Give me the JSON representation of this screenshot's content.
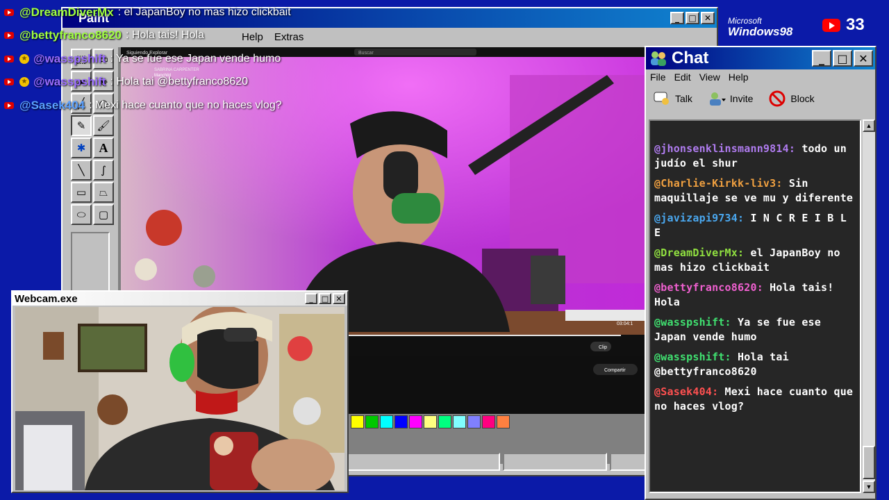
{
  "paint": {
    "title": "Paint",
    "menu": [
      "Help",
      "Extras"
    ],
    "palette": [
      "#ffff00",
      "#00ff00",
      "#00ffff",
      "#0000ff",
      "#ff00ff",
      "#ffff80",
      "#00ff80",
      "#80ffff",
      "#8080ff",
      "#ff0080",
      "#ff8040"
    ]
  },
  "stream_video": {
    "search_placeholder": "Buscar",
    "tabs": "Siguiendo   Explorar",
    "now_playing": "SABRINA CARPENTER",
    "now_playing_sub": "Manchild",
    "timestamp": "03:04:1",
    "clip_label": "Clip",
    "share_label": "Compartir"
  },
  "webcam": {
    "title": "Webcam.exe"
  },
  "chat": {
    "title": "Chat",
    "menu": [
      "File",
      "Edit",
      "View",
      "Help"
    ],
    "toolbar": {
      "talk": "Talk",
      "invite": "Invite",
      "block": "Block"
    },
    "messages": [
      {
        "user": "@jhonsenklinsmann9814:",
        "color": "#b07cf0",
        "text": "todo un judío el shur"
      },
      {
        "user": "@Charlie-Kirkk-liv3:",
        "color": "#f0a040",
        "text": "Sin maquillaje se ve mu y diferente"
      },
      {
        "user": "@javizapi9734:",
        "color": "#4aa8f0",
        "text": "I N C R E I B L E"
      },
      {
        "user": "@DreamDiverMx:",
        "color": "#90e040",
        "text": "el JapanBoy no mas hizo clickbait"
      },
      {
        "user": "@bettyfranco8620:",
        "color": "#f060d0",
        "text": "Hola tais! Hola"
      },
      {
        "user": "@wasspshift:",
        "color": "#40e070",
        "text": "Ya se fue ese Japan vende humo"
      },
      {
        "user": "@wasspshift:",
        "color": "#40e070",
        "text": "Hola tai @bettyfranco8620"
      },
      {
        "user": "@Sasek404:",
        "color": "#ff5050",
        "text": "Mexi hace cuanto que no haces vlog?"
      }
    ]
  },
  "overlay_chat": [
    {
      "user": "@DreamDiverMx",
      "color": "#a0ff40",
      "text": ": el JapanBoy no mas hizo clickbait",
      "star": false
    },
    {
      "user": "@bettyfranco8620",
      "color": "#a0ff40",
      "text": ": Hola tais! Hola",
      "star": false
    },
    {
      "user": "@wasspshift",
      "color": "#9a6cff",
      "text": ": Ya se fue ese Japan vende humo",
      "star": true
    },
    {
      "user": "@wasspshift",
      "color": "#9a6cff",
      "text": ": Hola tai @bettyfranco8620",
      "star": true
    },
    {
      "user": "@Sasek404",
      "color": "#5aa0ff",
      "text": ": Mexi hace cuanto que no haces vlog?",
      "star": false
    }
  ],
  "branding": {
    "ms_line1": "Microsoft",
    "ms_line2": "Windows98"
  },
  "viewers": {
    "count": "33"
  }
}
